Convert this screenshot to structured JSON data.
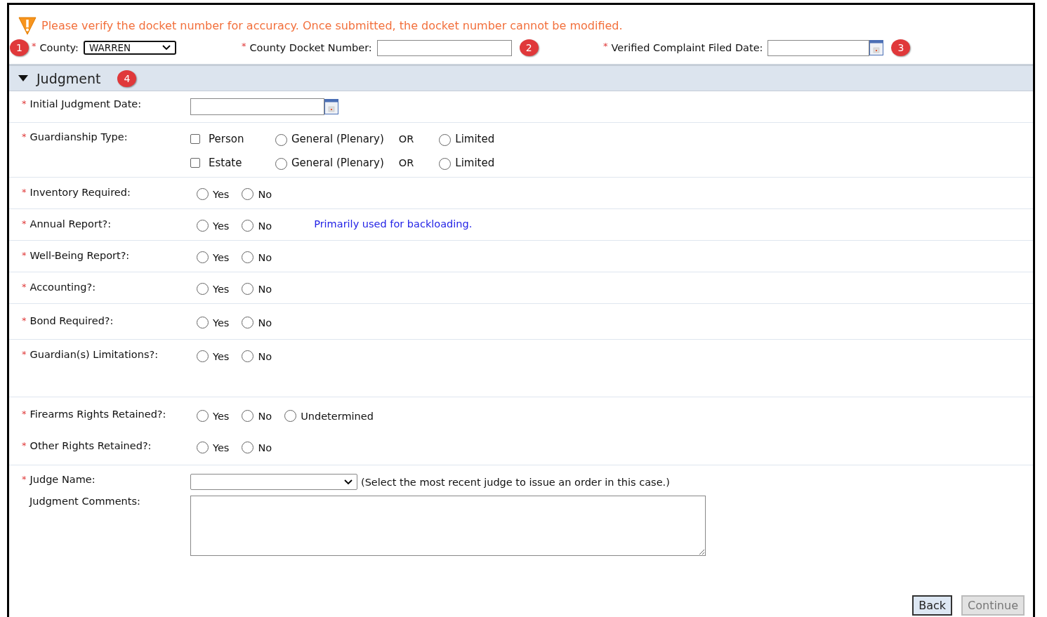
{
  "notice": {
    "text": "Please verify the docket number for accuracy. Once submitted, the docket number cannot be modified."
  },
  "header_fields": [
    {
      "kind": "select",
      "label": "County:",
      "required": "*",
      "value": "WARREN",
      "badge": "1"
    },
    {
      "kind": "text",
      "label": "County Docket Number:",
      "required": "*",
      "badge": "2"
    },
    {
      "kind": "date",
      "label": "Verified Complaint Filed Date:",
      "required": "*",
      "badge": "3"
    }
  ],
  "section": {
    "title": "Judgment",
    "expanded": true,
    "badge": "4"
  },
  "groups": [
    {
      "rows": [
        {
          "kind": "date",
          "label": "Initial Judgment Date:",
          "required": "*"
        }
      ]
    },
    {
      "rows": [
        {
          "kind": "guardianship",
          "label": "Guardianship Type:",
          "required": "*",
          "lines": [
            {
              "checkbox": {
                "label": "Person",
                "checked": false
              },
              "separator": "OR",
              "options": [
                {
                  "label": "General (Plenary)",
                  "selected": false
                },
                {
                  "label": "Limited",
                  "selected": false
                }
              ]
            },
            {
              "checkbox": {
                "label": "Estate",
                "checked": false
              },
              "separator": "OR",
              "options": [
                {
                  "label": "General (Plenary)",
                  "selected": false
                },
                {
                  "label": "Limited",
                  "selected": false
                }
              ]
            }
          ]
        }
      ]
    },
    {
      "rows": [
        {
          "kind": "radios",
          "label": "Inventory Required:",
          "required": "*",
          "options": [
            {
              "label": "Yes",
              "selected": false
            },
            {
              "label": "No",
              "selected": false
            }
          ]
        }
      ]
    },
    {
      "rows": [
        {
          "kind": "radios",
          "label": "Annual Report?:",
          "required": "*",
          "options": [
            {
              "label": "Yes",
              "selected": false
            },
            {
              "label": "No",
              "selected": false
            }
          ],
          "note": "Primarily used for backloading."
        }
      ]
    },
    {
      "rows": [
        {
          "kind": "radios",
          "label": "Well-Being Report?:",
          "required": "*",
          "options": [
            {
              "label": "Yes",
              "selected": false
            },
            {
              "label": "No",
              "selected": false
            }
          ]
        }
      ]
    },
    {
      "rows": [
        {
          "kind": "radios",
          "label": "Accounting?:",
          "required": "*",
          "options": [
            {
              "label": "Yes",
              "selected": false
            },
            {
              "label": "No",
              "selected": false
            }
          ]
        }
      ]
    },
    {
      "rows": [
        {
          "kind": "radios",
          "label": "Bond Required?:",
          "required": "*",
          "options": [
            {
              "label": "Yes",
              "selected": false
            },
            {
              "label": "No",
              "selected": false
            }
          ]
        }
      ]
    },
    {
      "rows": [
        {
          "kind": "radios",
          "label": "Guardian(s) Limitations?:",
          "required": "*",
          "options": [
            {
              "label": "Yes",
              "selected": false
            },
            {
              "label": "No",
              "selected": false
            }
          ]
        }
      ]
    },
    {
      "rows": [
        {
          "kind": "radios",
          "label": "Firearms Rights Retained?:",
          "required": "*",
          "options": [
            {
              "label": "Yes",
              "selected": false
            },
            {
              "label": "No",
              "selected": false
            },
            {
              "label": "Undetermined",
              "selected": false
            }
          ]
        },
        {
          "kind": "radios",
          "label": "Other Rights Retained?:",
          "required": "*",
          "options": [
            {
              "label": "Yes",
              "selected": false
            },
            {
              "label": "No",
              "selected": false
            }
          ]
        }
      ]
    },
    {
      "rows": [
        {
          "kind": "select",
          "label": "Judge Name:",
          "required": "*",
          "hint": "(Select the most recent judge to issue an order in this case.)"
        },
        {
          "kind": "textarea",
          "label": "Judgment Comments:"
        }
      ]
    }
  ],
  "buttons": [
    {
      "label": "Back",
      "disabled": false
    },
    {
      "label": "Continue",
      "disabled": true
    }
  ]
}
